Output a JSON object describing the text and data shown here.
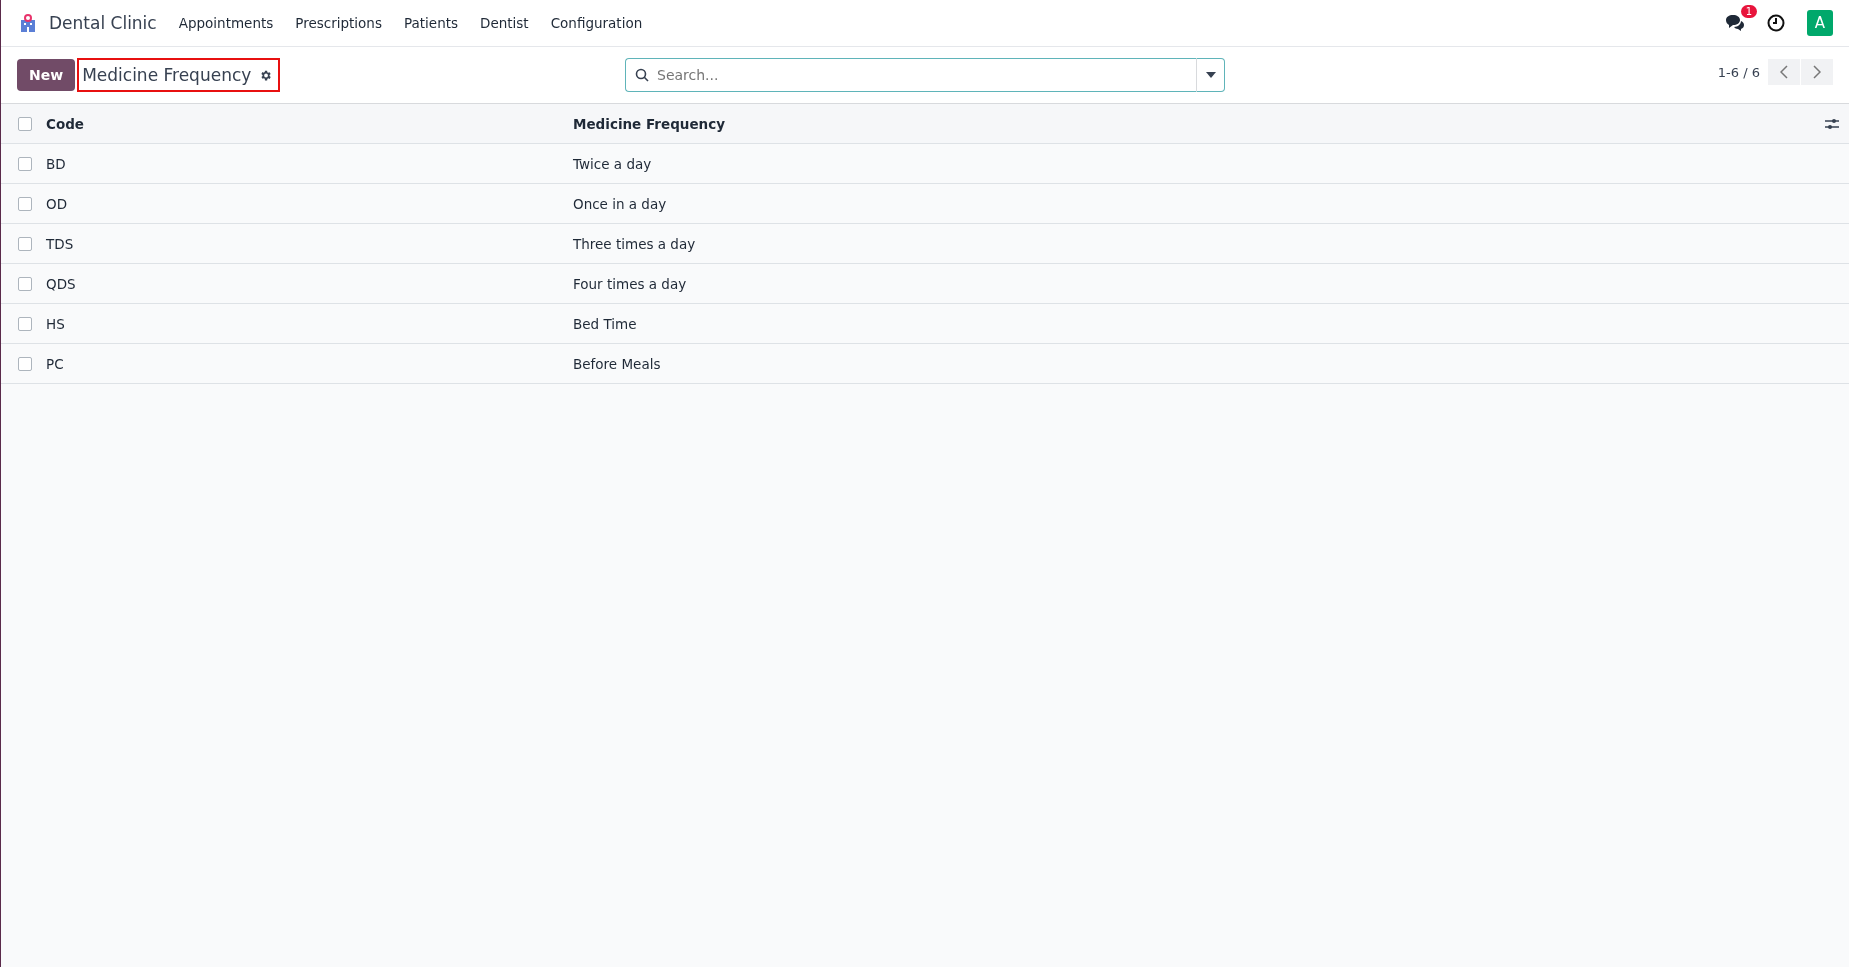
{
  "navbar": {
    "app_name": "Dental Clinic",
    "menu": [
      "Appointments",
      "Prescriptions",
      "Patients",
      "Dentist",
      "Configuration"
    ],
    "messages_badge": "1",
    "avatar": "A"
  },
  "control_panel": {
    "new_button": "New",
    "title": "Medicine Frequency",
    "search": {
      "placeholder": "Search..."
    },
    "pager": "1-6 / 6"
  },
  "table": {
    "select_all": {
      "checked": false
    },
    "columns": [
      "Code",
      "Medicine Frequency"
    ],
    "rows": [
      {
        "checked": false,
        "cells": [
          "BD",
          "Twice a day"
        ]
      },
      {
        "checked": false,
        "cells": [
          "OD",
          "Once in a day"
        ]
      },
      {
        "checked": false,
        "cells": [
          "TDS",
          "Three times a day"
        ]
      },
      {
        "checked": false,
        "cells": [
          "QDS",
          "Four times a day"
        ]
      },
      {
        "checked": false,
        "cells": [
          "HS",
          "Bed Time"
        ]
      },
      {
        "checked": false,
        "cells": [
          "PC",
          "Before Meals"
        ]
      }
    ]
  }
}
